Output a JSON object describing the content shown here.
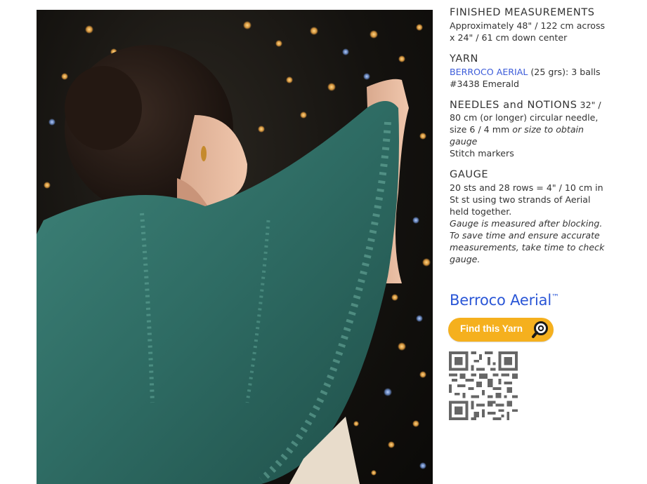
{
  "photo": {
    "alt": "Model wearing a teal lace shawl in front of bokeh lights"
  },
  "sections": {
    "finished": {
      "heading": "FINISHED MEASUREMENTS",
      "line1": "Approximately 48\" / 122 cm across",
      "line2": "x 24\" / 61 cm down center"
    },
    "yarn": {
      "heading": "YARN",
      "link": "BERROCO AERIAL",
      "rest": " (25 grs): 3 balls",
      "line2": "#3438 Emerald"
    },
    "needles": {
      "heading": "NEEDLES and NOTIONS",
      "tail1": " 32\" /",
      "line2": "80 cm (or longer) circular needle,",
      "line3_plain": "size 6 / 4 mm ",
      "line3_italic": "or size to obtain",
      "line4_italic": "gauge",
      "line5": "Stitch markers"
    },
    "gauge": {
      "heading": "GAUGE",
      "line1": "20 sts and 28 rows = 4\" / 10 cm in",
      "line2": "St st using two strands of Aerial",
      "line3": "held together.",
      "italic1": "Gauge is measured after blocking.",
      "italic2": "To save time and ensure accurate",
      "italic3": "measurements, take time to check",
      "italic4": "gauge."
    }
  },
  "brand": {
    "name": "Berroco Aerial",
    "tm": "™"
  },
  "find_button": {
    "label": "Find this Yarn",
    "icon": "magnifier-icon"
  },
  "qr": {
    "icon": "qr-code-icon"
  },
  "colors": {
    "link": "#3b5bd9",
    "brand": "#2a56d6",
    "button": "#f5b01e",
    "shawl": "#2e6b63"
  }
}
